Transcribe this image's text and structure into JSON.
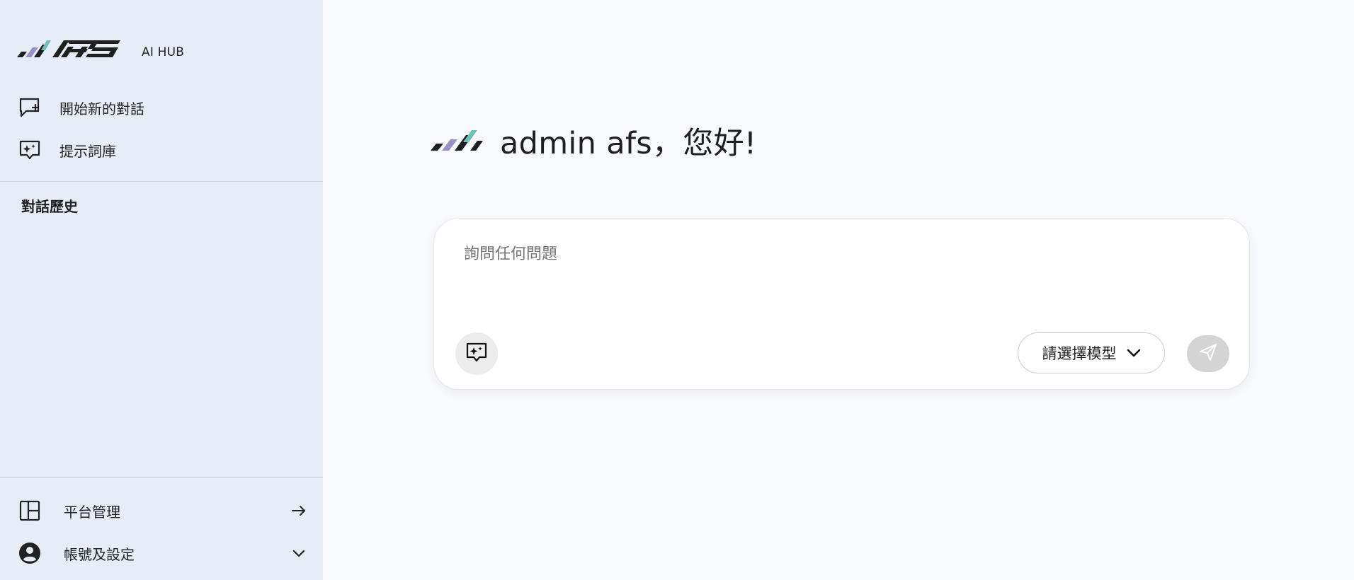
{
  "logo": {
    "sub_label": "AI HUB",
    "brand_text": "AFS",
    "colors": {
      "teal": "#6fbfb9",
      "purple": "#9b8fc7",
      "dark": "#1f1f1f"
    }
  },
  "sidebar": {
    "new_chat": {
      "label": "開始新的對話",
      "icon": "new-chat-icon"
    },
    "prompt_library": {
      "label": "提示詞庫",
      "icon": "prompt-library-icon"
    },
    "history_title": "對話歷史",
    "platform_admin": {
      "label": "平台管理",
      "icon": "layout-icon",
      "trail_icon": "arrow-right-icon"
    },
    "account_settings": {
      "label": "帳號及設定",
      "icon": "account-circle-icon",
      "trail_icon": "chevron-down-icon"
    }
  },
  "main": {
    "greeting": "admin afs，您好!",
    "composer": {
      "placeholder": "詢問任何問題",
      "model_select_label": "請選擇模型",
      "send_icon": "send-icon",
      "prompt_icon": "prompt-library-icon"
    }
  },
  "colors": {
    "sidebar_bg": "#e8ecf7",
    "main_bg": "#f7f9fd",
    "send_disabled": "#d4d4d4"
  }
}
